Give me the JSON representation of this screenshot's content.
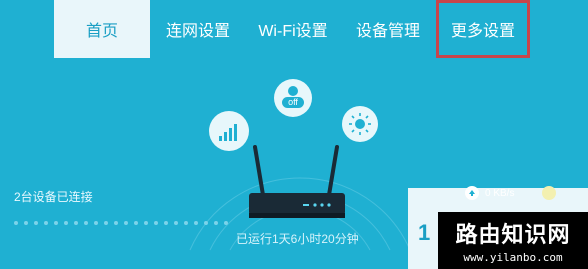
{
  "nav": {
    "tabs": [
      {
        "label": "首页",
        "active": true
      },
      {
        "label": "连网设置"
      },
      {
        "label": "Wi-Fi设置"
      },
      {
        "label": "设备管理"
      },
      {
        "label": "更多设置",
        "highlighted": true
      }
    ]
  },
  "status": {
    "connected_devices": "2台设备已连接",
    "uptime": "已运行1天6小时20分钟",
    "wifi_toggle_label": "off"
  },
  "speed": {
    "upload_unit": "0 KB/s",
    "digit": "1"
  },
  "watermark": {
    "title": "路由知识网",
    "url": "www.yilanbo.com"
  },
  "colors": {
    "background": "#1fb0d2",
    "panel": "#e9f6fa",
    "highlight": "#c8464b",
    "accent_text": "#1a9fc4"
  }
}
